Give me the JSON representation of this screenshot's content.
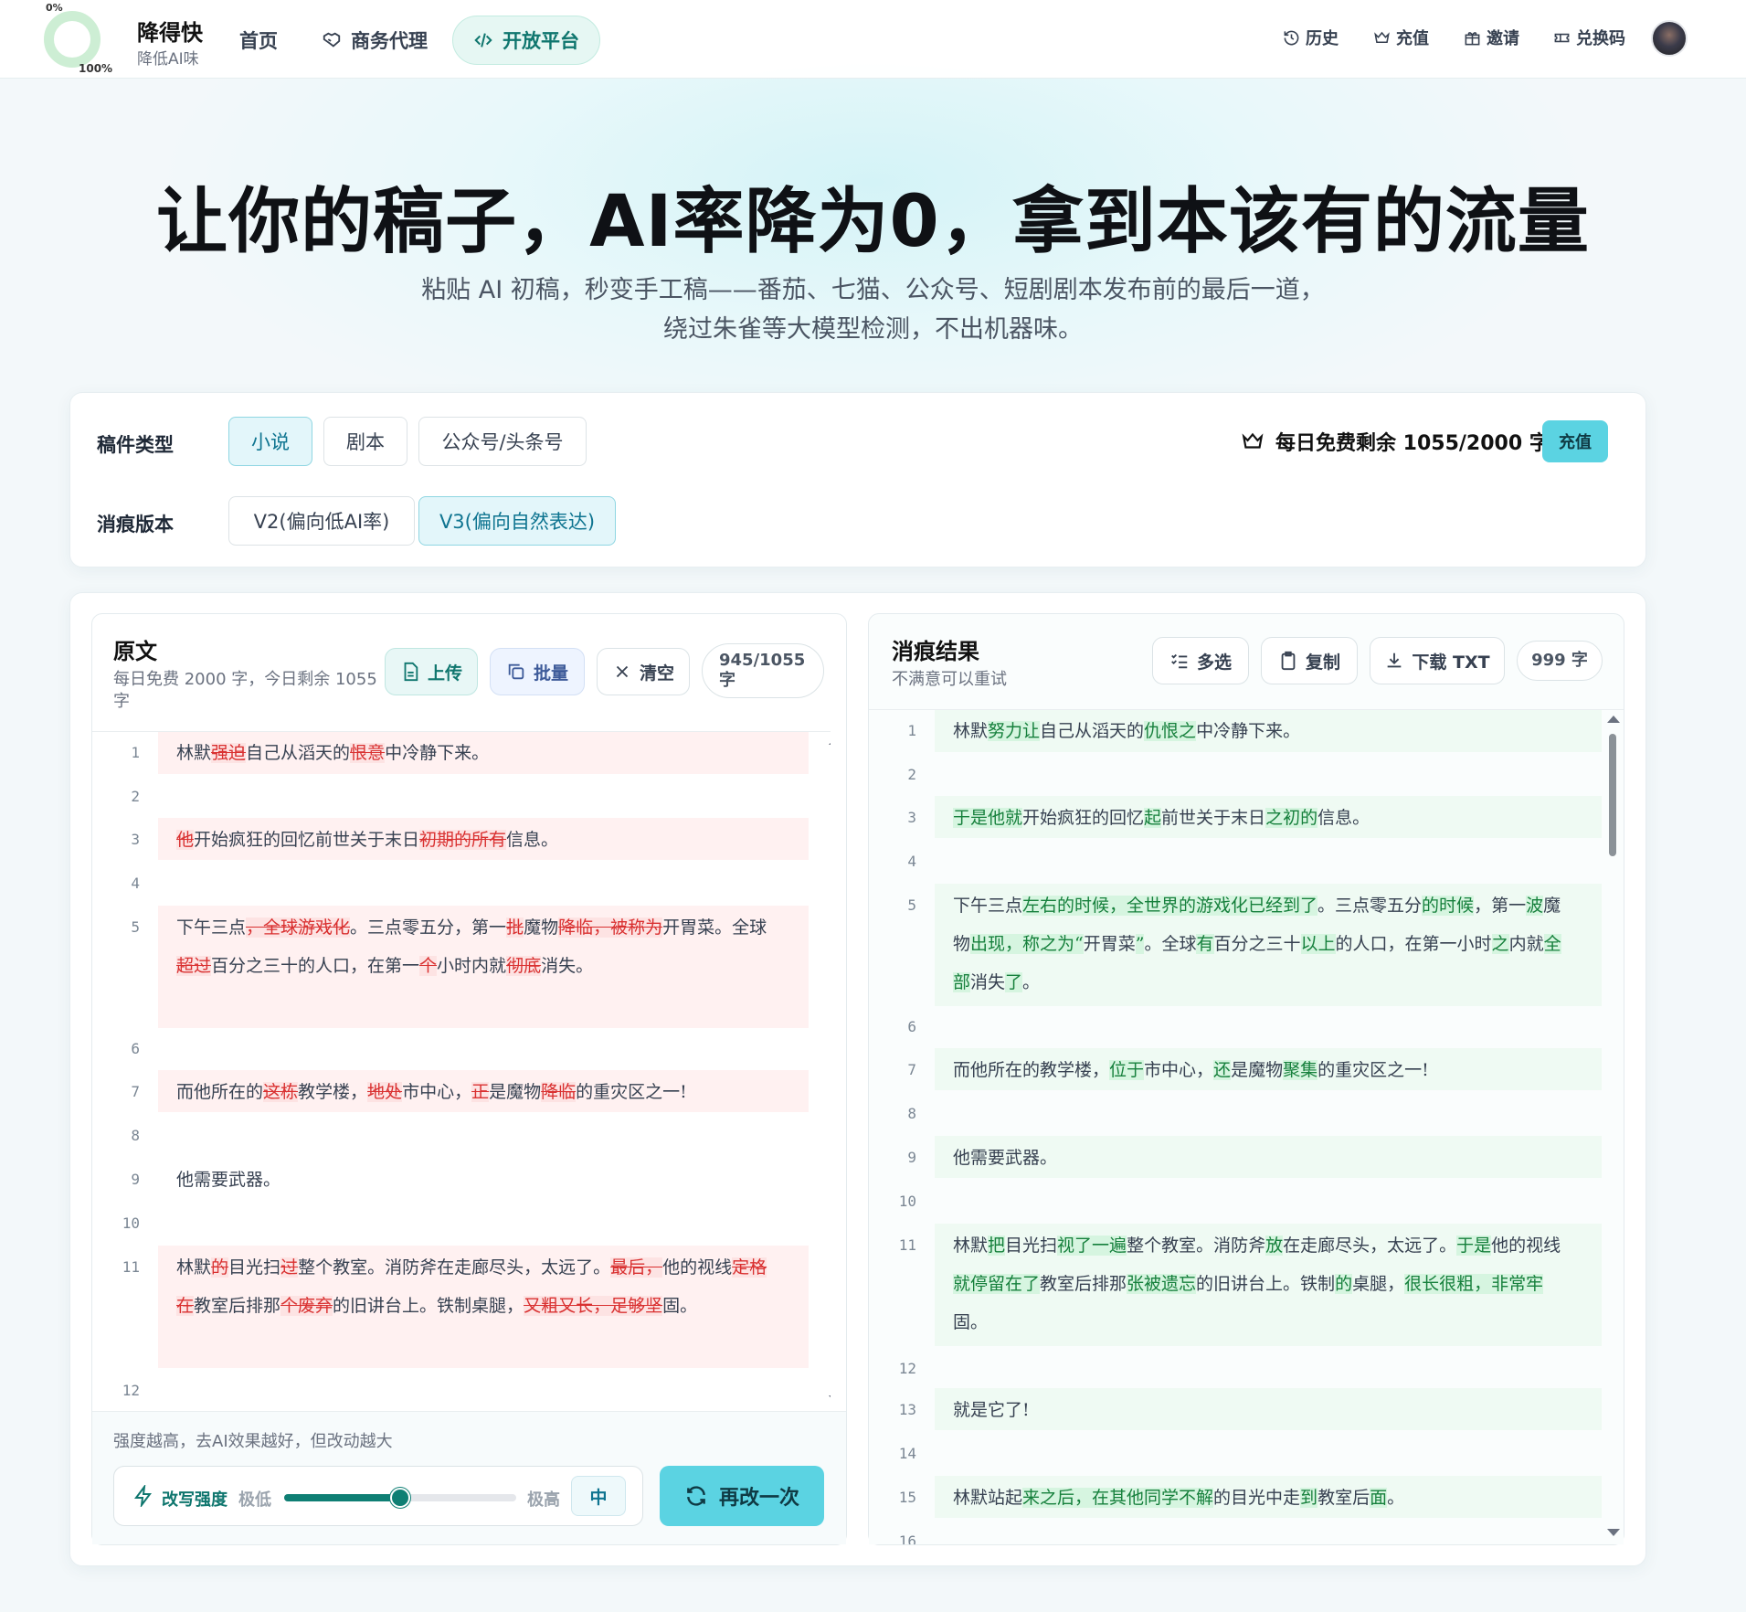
{
  "header": {
    "progress_min": "0%",
    "progress_max": "100%",
    "brand_name": "降得快",
    "brand_tagline": "降低AI味",
    "nav": {
      "home": "首页",
      "agency": "商务代理",
      "open_platform": "开放平台"
    },
    "right_nav": {
      "history": "历史",
      "recharge": "充值",
      "invite": "邀请",
      "redeem": "兑换码"
    }
  },
  "hero": {
    "title": "让你的稿子，AI率降为0，拿到本该有的流量",
    "subtitle_line1": "粘贴 AI 初稿，秒变手工稿——番茄、七猫、公众号、短剧剧本发布前的最后一道，",
    "subtitle_line2": "绕过朱雀等大模型检测，不出机器味。"
  },
  "options": {
    "type_label": "稿件类型",
    "types": [
      "小说",
      "剧本",
      "公众号/头条号"
    ],
    "selected_type": "小说",
    "version_label": "消痕版本",
    "versions": [
      "V2(偏向低AI率)",
      "V3(偏向自然表达)"
    ],
    "selected_version": "V3(偏向自然表达)",
    "quota_text": "每日免费剩余 1055/2000 字",
    "recharge_button": "充值"
  },
  "source_panel": {
    "title": "原文",
    "subtitle": "每日免费 2000 字，今日剩余 1055 字",
    "upload": "上传",
    "batch": "批量",
    "clear": "清空",
    "count": "945/1055 字",
    "hint": "强度越高，去AI效果越好，但改动越大",
    "strength": {
      "label": "改写强度",
      "min": "极低",
      "max": "极高",
      "value_label": "中",
      "level_pct": 50
    },
    "retry_button": "再改一次"
  },
  "result_panel": {
    "title": "消痕结果",
    "subtitle": "不满意可以重试",
    "multi_select": "多选",
    "copy": "复制",
    "download": "下载 TXT",
    "count": "999 字"
  },
  "colors": {
    "accent": "#5bd3e2",
    "deleted": "#d93030",
    "inserted": "#16803c",
    "brand_green": "#0f766e"
  }
}
